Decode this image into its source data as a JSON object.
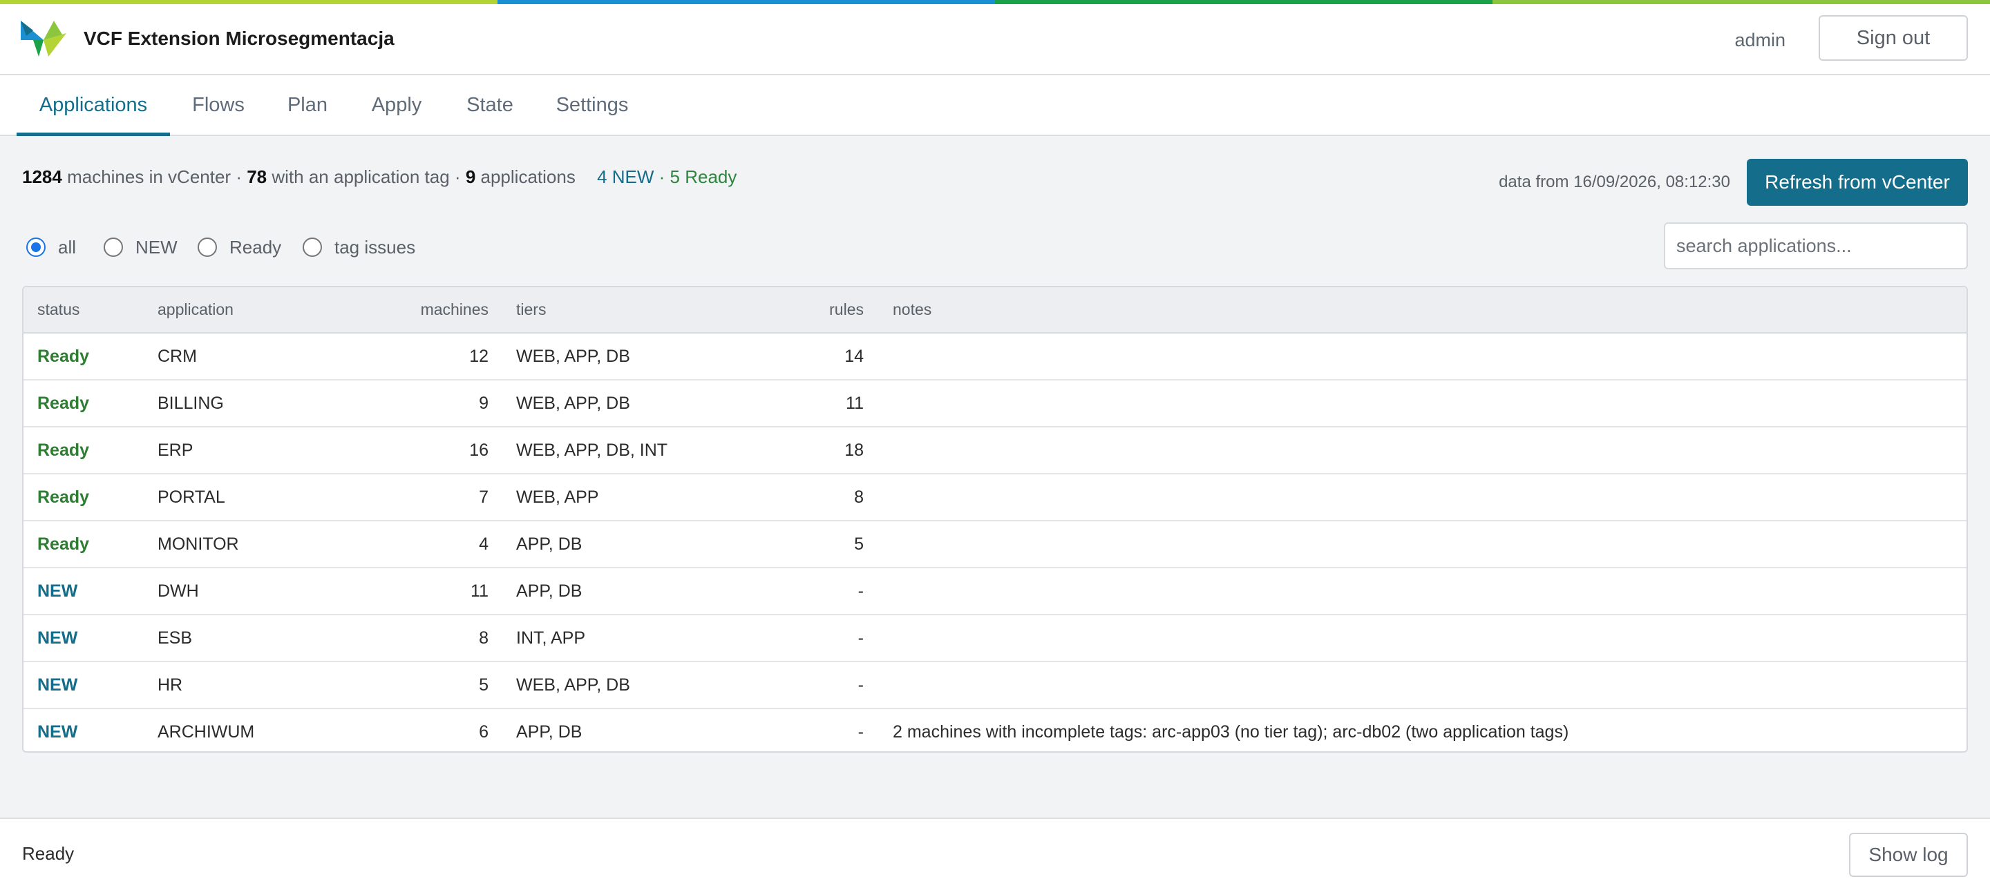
{
  "colors": {
    "accent_bar": [
      "#b4d334",
      "#1a8fd1",
      "#1aa14a",
      "#8cc63f"
    ],
    "primary": "#146d8a",
    "status_ready": "#2e7d32",
    "status_new": "#146d8a"
  },
  "header": {
    "logo_icon": "vcf-logo-icon",
    "title": "VCF Extension Microsegmentacja",
    "user": "admin",
    "signout_label": "Sign out"
  },
  "tabs": [
    {
      "label": "Applications",
      "active": true
    },
    {
      "label": "Flows",
      "active": false
    },
    {
      "label": "Plan",
      "active": false
    },
    {
      "label": "Apply",
      "active": false
    },
    {
      "label": "State",
      "active": false
    },
    {
      "label": "Settings",
      "active": false
    }
  ],
  "summary": {
    "machines_count": "1284",
    "machines_text": "machines in vCenter",
    "tagged_count": "78",
    "tagged_text": "with an application tag",
    "apps_count": "9",
    "apps_text": "applications",
    "sep": "·",
    "new_text": "4 NEW",
    "ready_text": "5 Ready",
    "data_from": "data from 16/09/2026, 08:12:30",
    "refresh_label": "Refresh from vCenter"
  },
  "filters": {
    "options": [
      {
        "label": "all",
        "checked": true
      },
      {
        "label": "NEW",
        "checked": false
      },
      {
        "label": "Ready",
        "checked": false
      },
      {
        "label": "tag issues",
        "checked": false
      }
    ],
    "search_placeholder": "search applications..."
  },
  "table": {
    "columns": [
      "status",
      "application",
      "machines",
      "tiers",
      "rules",
      "notes"
    ],
    "rows": [
      {
        "status": "Ready",
        "application": "CRM",
        "machines": "12",
        "tiers": "WEB, APP, DB",
        "rules": "14",
        "notes": ""
      },
      {
        "status": "Ready",
        "application": "BILLING",
        "machines": "9",
        "tiers": "WEB, APP, DB",
        "rules": "11",
        "notes": ""
      },
      {
        "status": "Ready",
        "application": "ERP",
        "machines": "16",
        "tiers": "WEB, APP, DB, INT",
        "rules": "18",
        "notes": ""
      },
      {
        "status": "Ready",
        "application": "PORTAL",
        "machines": "7",
        "tiers": "WEB, APP",
        "rules": "8",
        "notes": ""
      },
      {
        "status": "Ready",
        "application": "MONITOR",
        "machines": "4",
        "tiers": "APP, DB",
        "rules": "5",
        "notes": ""
      },
      {
        "status": "NEW",
        "application": "DWH",
        "machines": "11",
        "tiers": "APP, DB",
        "rules": "-",
        "notes": ""
      },
      {
        "status": "NEW",
        "application": "ESB",
        "machines": "8",
        "tiers": "INT, APP",
        "rules": "-",
        "notes": ""
      },
      {
        "status": "NEW",
        "application": "HR",
        "machines": "5",
        "tiers": "WEB, APP, DB",
        "rules": "-",
        "notes": ""
      },
      {
        "status": "NEW",
        "application": "ARCHIWUM",
        "machines": "6",
        "tiers": "APP, DB",
        "rules": "-",
        "notes": "2 machines with incomplete tags: arc-app03 (no tier tag); arc-db02 (two application tags)"
      }
    ]
  },
  "footer": {
    "status": "Ready",
    "showlog_label": "Show log"
  }
}
